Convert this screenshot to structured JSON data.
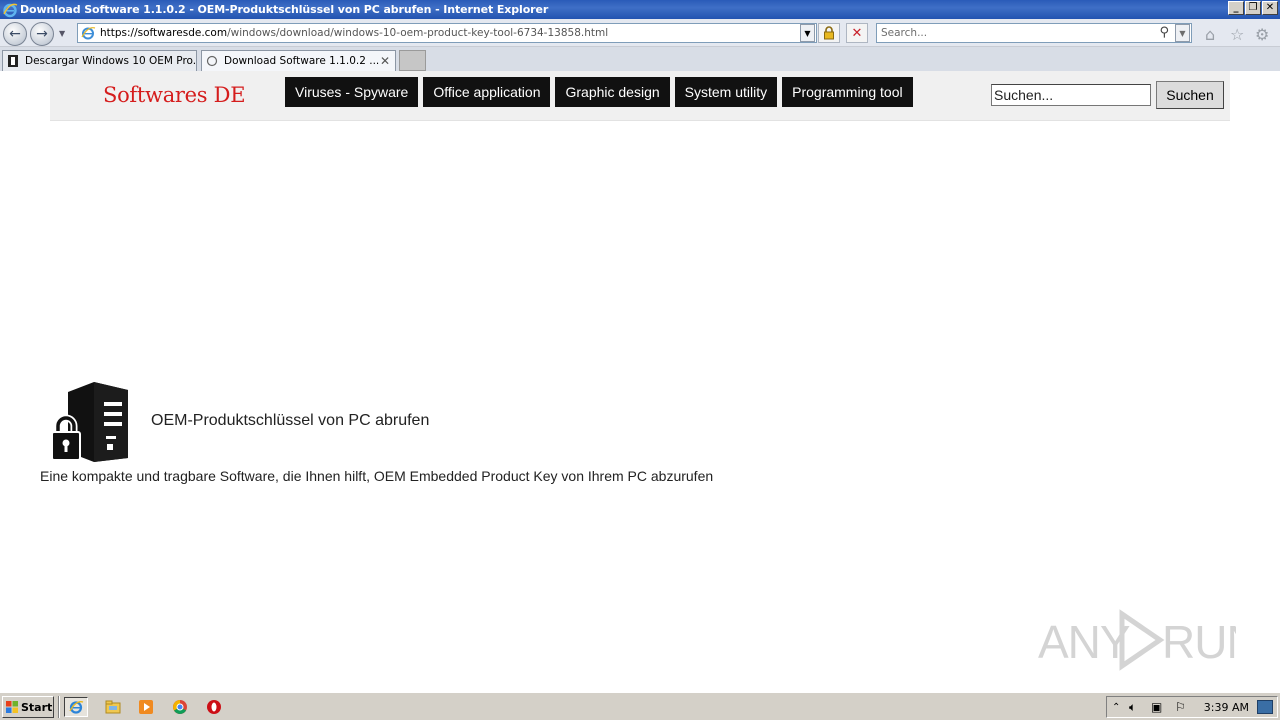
{
  "window": {
    "title": "Download Software 1.1.0.2 - OEM-Produktschlüssel von PC abrufen - Internet Explorer",
    "controls": {
      "minimize": "_",
      "restore": "❐",
      "close": "✕"
    }
  },
  "address_bar": {
    "url_host": "https://softwaresde.com",
    "url_path": "/windows/download/windows-10-oem-product-key-tool-6734-13858.html"
  },
  "browser_search": {
    "placeholder": "Search..."
  },
  "tabs": [
    {
      "label": "Descargar Windows 10 OEM Pro...",
      "active": false
    },
    {
      "label": "Download Software 1.1.0.2 ...",
      "active": true,
      "close": "✕"
    }
  ],
  "site": {
    "logo": "Softwares DE",
    "menu": [
      "Viruses - Spyware",
      "Office application",
      "Graphic design",
      "System utility",
      "Programming tool"
    ],
    "search_placeholder": "Suchen...",
    "search_button": "Suchen"
  },
  "app": {
    "title": "OEM-Produktschlüssel von PC abrufen",
    "description": "Eine kompakte und tragbare Software, die Ihnen hilft, OEM Embedded Product Key von Ihrem PC abzurufen"
  },
  "watermark": "ANY RUN",
  "taskbar": {
    "start_label": "Start",
    "clock": "3:39 AM"
  },
  "colors": {
    "logo": "#d51d1d",
    "menu_bg": "#111111",
    "title_bar": "#2a5bb8"
  }
}
